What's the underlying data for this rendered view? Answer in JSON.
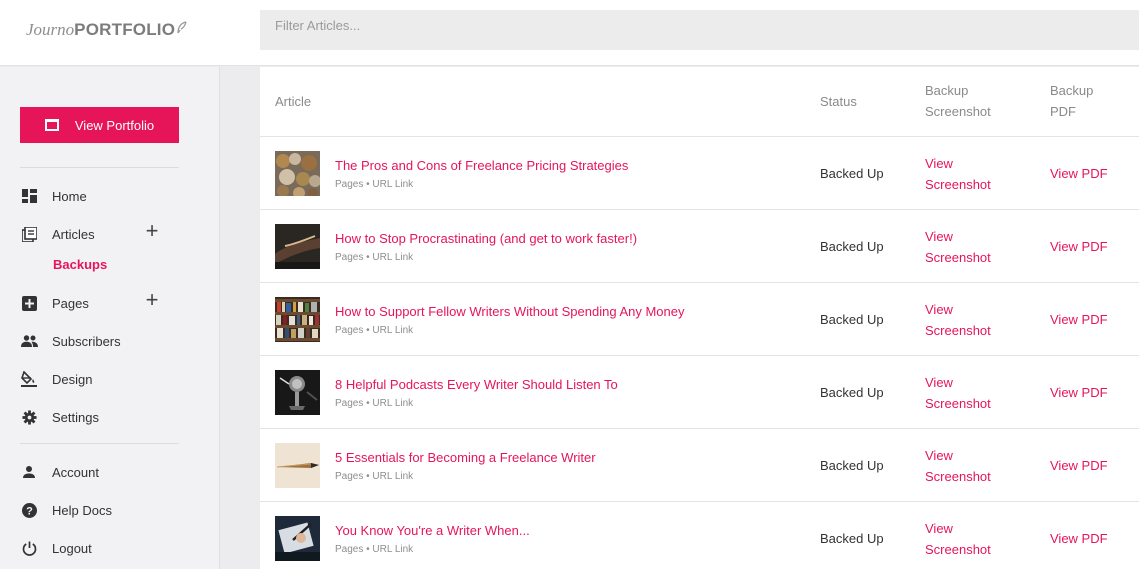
{
  "brand": {
    "journo": "Journo",
    "portfolio": "PORTFOLIO"
  },
  "filter": {
    "placeholder": "Filter Articles..."
  },
  "sidebar": {
    "view_portfolio": "View Portfolio",
    "items": [
      {
        "label": "Home",
        "icon": "dashboard-icon"
      },
      {
        "label": "Articles",
        "icon": "articles-icon"
      },
      {
        "label": "Pages",
        "icon": "pages-icon"
      },
      {
        "label": "Subscribers",
        "icon": "people-icon"
      },
      {
        "label": "Design",
        "icon": "paint-bucket-icon"
      },
      {
        "label": "Settings",
        "icon": "gear-icon"
      },
      {
        "label": "Account",
        "icon": "person-icon"
      },
      {
        "label": "Help Docs",
        "icon": "help-icon"
      },
      {
        "label": "Logout",
        "icon": "power-icon"
      }
    ],
    "articles_sub": "Backups",
    "plus": "+",
    "accent": "#e6155a"
  },
  "table": {
    "headers": {
      "article": "Article",
      "status": "Status",
      "backup_ss_1": "Backup",
      "backup_ss_2": "Screenshot",
      "backup_pdf_1": "Backup",
      "backup_pdf_2": "PDF"
    },
    "rows": [
      {
        "title": "The Pros and Cons of Freelance Pricing Strategies",
        "meta": "Pages • URL Link",
        "status": "Backed Up",
        "ss_1": "View",
        "ss_2": "Screenshot",
        "pdf": "View PDF"
      },
      {
        "title": "How to Stop Procrastinating (and get to work faster!)",
        "meta": "Pages • URL Link",
        "status": "Backed Up",
        "ss_1": "View",
        "ss_2": "Screenshot",
        "pdf": "View PDF"
      },
      {
        "title": "How to Support Fellow Writers Without Spending Any Money",
        "meta": "Pages • URL Link",
        "status": "Backed Up",
        "ss_1": "View",
        "ss_2": "Screenshot",
        "pdf": "View PDF"
      },
      {
        "title": "8 Helpful Podcasts Every Writer Should Listen To",
        "meta": "Pages • URL Link",
        "status": "Backed Up",
        "ss_1": "View",
        "ss_2": "Screenshot",
        "pdf": "View PDF"
      },
      {
        "title": "5 Essentials for Becoming a Freelance Writer",
        "meta": "Pages • URL Link",
        "status": "Backed Up",
        "ss_1": "View",
        "ss_2": "Screenshot",
        "pdf": "View PDF"
      },
      {
        "title": "You Know You're a Writer When...",
        "meta": "Pages • URL Link",
        "status": "Backed Up",
        "ss_1": "View",
        "ss_2": "Screenshot",
        "pdf": "View PDF"
      }
    ]
  }
}
